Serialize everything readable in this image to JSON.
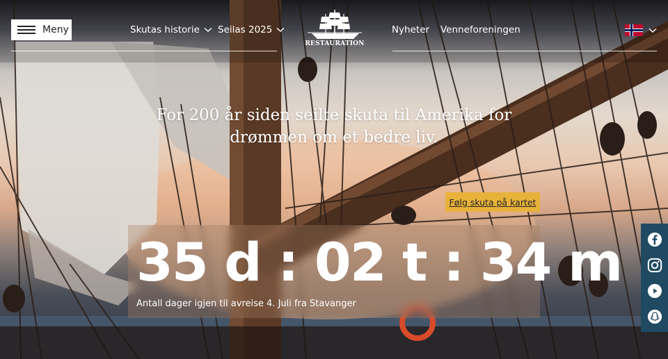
{
  "header": {
    "menu_label": "Meny",
    "nav": [
      {
        "label": "Skutas historie",
        "has_dropdown": true
      },
      {
        "label": "Seilas 2025",
        "has_dropdown": true
      },
      {
        "label": "Nyheter",
        "has_dropdown": false
      },
      {
        "label": "Venneforeningen",
        "has_dropdown": false
      }
    ],
    "logo_text": "RESTAURATION",
    "language": {
      "flag": "norway-flag-icon",
      "has_dropdown": true
    }
  },
  "hero": {
    "tagline": "For 200 år siden seilte skuta til Amerika for drømmen om et bedre liv.",
    "follow_button": "Følg skuta på kartet"
  },
  "countdown": {
    "display": "35 d : 02 t : 34 m",
    "days": 35,
    "hours": 2,
    "minutes": 34,
    "caption": "Antall dager igjen til avreise 4. Juli fra Stavanger"
  },
  "social": [
    {
      "name": "facebook-icon"
    },
    {
      "name": "instagram-icon"
    },
    {
      "name": "youtube-icon"
    },
    {
      "name": "snapchat-icon"
    }
  ],
  "colors": {
    "accent_button": "#e8b23a",
    "social_bar": "#1f4a62",
    "menu_button_bg": "#ffffff"
  }
}
